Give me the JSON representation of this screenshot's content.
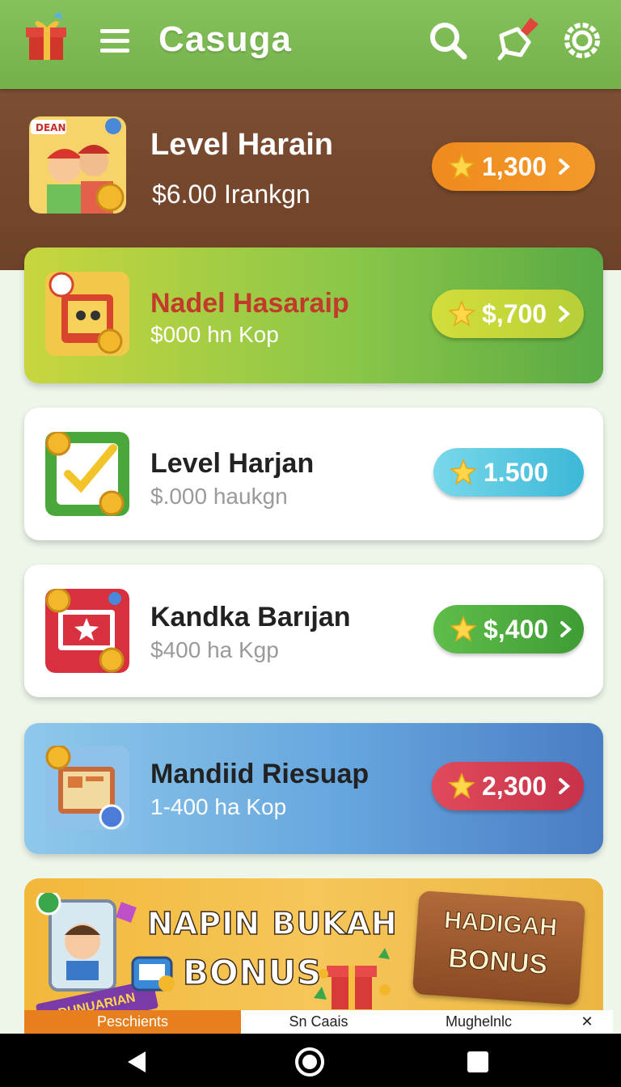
{
  "app": {
    "title": "Casuga"
  },
  "items": [
    {
      "name": "Level Harain",
      "sub": "$6.00 Irankgn",
      "price": "1,300"
    },
    {
      "name": "Nadel Hasaraip",
      "sub": "$000 hn Kop",
      "price": "$,700"
    },
    {
      "name": "Level Harjan",
      "sub": "$.000 haukgn",
      "price": "1.500"
    },
    {
      "name": "Kandka Barıjan",
      "sub": "$400 ha Kgp",
      "price": "$,400"
    },
    {
      "name": "Mandiid Riesuap",
      "sub": "1-400 ha Kop",
      "price": "2,300"
    }
  ],
  "banner": {
    "headline_1": "NAPIN BUKAH",
    "headline_2": "BONUS",
    "sign_1": "HADIGAH",
    "sign_2": "BONUS",
    "ribbon": "DUNUARIAN"
  },
  "tabs": [
    "Peschients",
    "Sn Caais",
    "Mughelnlc",
    "✕"
  ],
  "colors": {
    "appbar": "#78b64e",
    "orange": "#ef8a1f",
    "lime": "#c9d63a",
    "cyan": "#4cc6e0",
    "green": "#4aa33a",
    "red": "#d43a55"
  }
}
